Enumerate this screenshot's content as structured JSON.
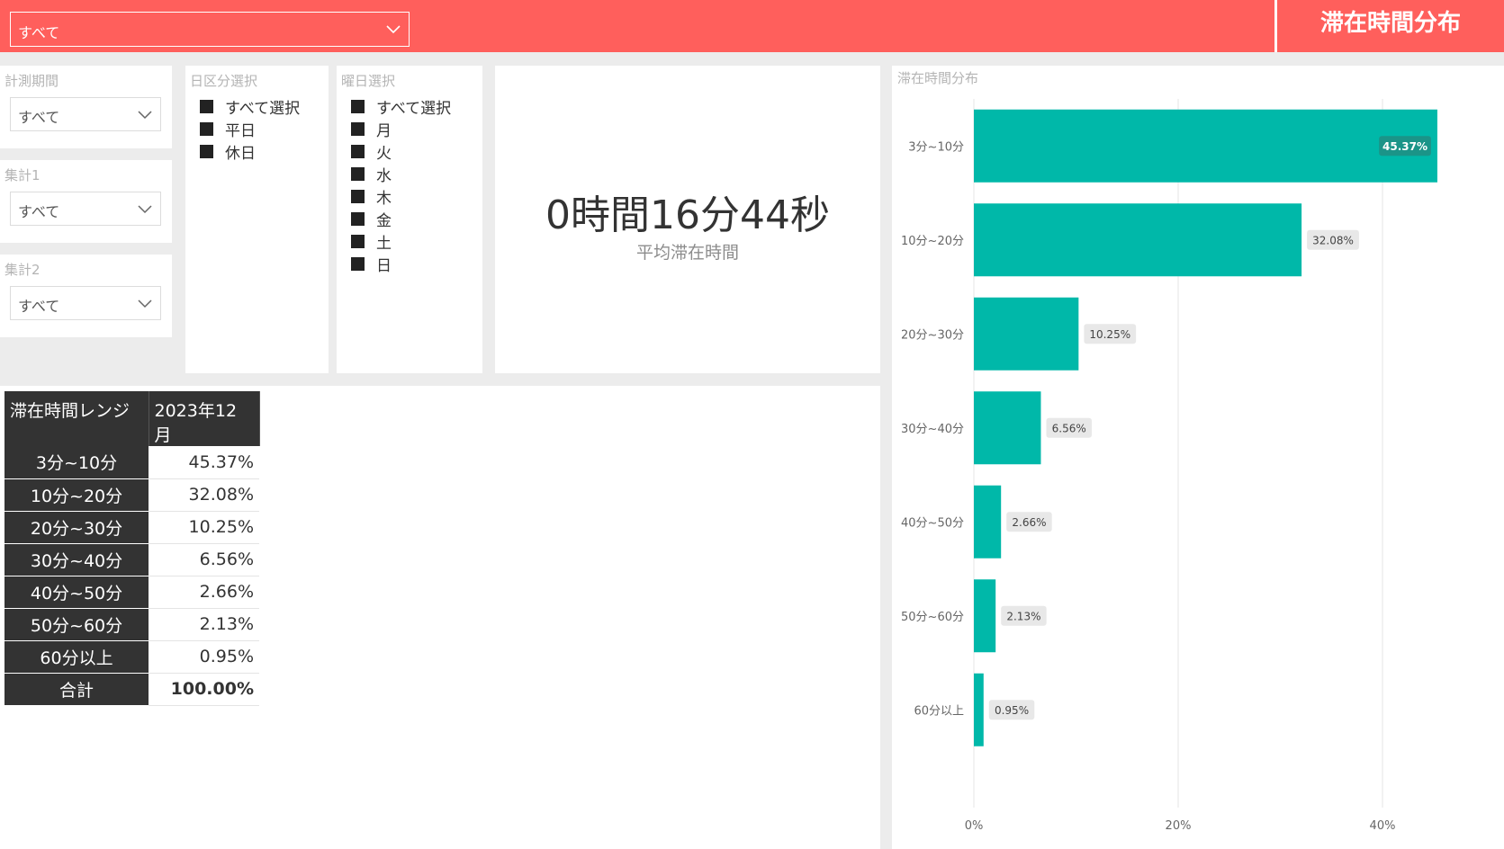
{
  "header": {
    "dropdown_value": "すべて",
    "title": "滞在時間分布"
  },
  "filters": {
    "period": {
      "label": "計測期間",
      "value": "すべて"
    },
    "agg1": {
      "label": "集計1",
      "value": "すべて"
    },
    "agg2": {
      "label": "集計2",
      "value": "すべて"
    }
  },
  "day_category": {
    "label": "日区分選択",
    "items": [
      "すべて選択",
      "平日",
      "休日"
    ]
  },
  "weekday": {
    "label": "曜日選択",
    "items": [
      "すべて選択",
      "月",
      "火",
      "水",
      "木",
      "金",
      "土",
      "日"
    ]
  },
  "kpi": {
    "value": "0時間16分44秒",
    "label": "平均滞在時間"
  },
  "table": {
    "headers": [
      "滞在時間レンジ",
      "2023年12月"
    ],
    "rows": [
      {
        "range": "3分~10分",
        "value": "45.37%"
      },
      {
        "range": "10分~20分",
        "value": "32.08%"
      },
      {
        "range": "20分~30分",
        "value": "10.25%"
      },
      {
        "range": "30分~40分",
        "value": "6.56%"
      },
      {
        "range": "40分~50分",
        "value": "2.66%"
      },
      {
        "range": "50分~60分",
        "value": "2.13%"
      },
      {
        "range": "60分以上",
        "value": "0.95%"
      }
    ],
    "total": {
      "range": "合計",
      "value": "100.00%"
    }
  },
  "colors": {
    "accent": "#ff5f5c",
    "bar": "#00b8a9",
    "table_header": "#333333"
  },
  "chart_data": {
    "type": "bar",
    "orientation": "horizontal",
    "title": "滞在時間分布",
    "categories": [
      "3分~10分",
      "10分~20分",
      "20分~30分",
      "30分~40分",
      "40分~50分",
      "50分~60分",
      "60分以上"
    ],
    "values": [
      45.37,
      32.08,
      10.25,
      6.56,
      2.66,
      2.13,
      0.95
    ],
    "value_labels": [
      "45.37%",
      "32.08%",
      "10.25%",
      "6.56%",
      "2.66%",
      "2.13%",
      "0.95%"
    ],
    "xlim": [
      0,
      50
    ],
    "x_ticks": [
      0,
      20,
      40
    ],
    "x_tick_labels": [
      "0%",
      "20%",
      "40%"
    ],
    "grid": true
  }
}
